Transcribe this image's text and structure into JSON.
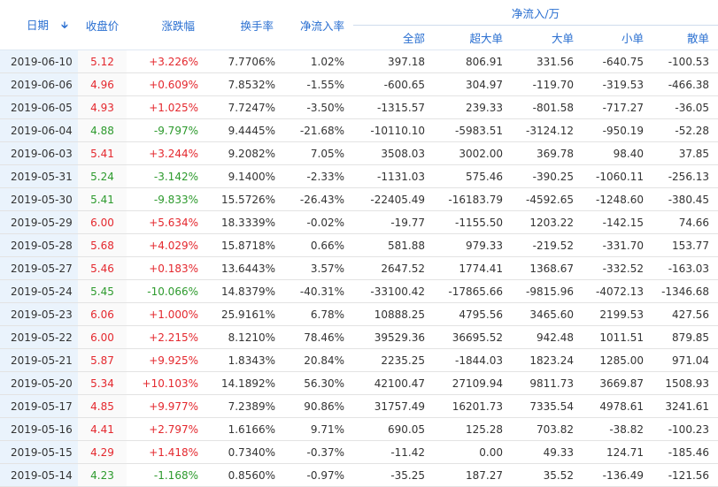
{
  "header": {
    "date": "日期",
    "sort_icon": "arrow-down",
    "close": "收盘价",
    "change": "涨跌幅",
    "turnover": "换手率",
    "netflow_rate": "净流入率",
    "netflow_group": "净流入/万",
    "all": "全部",
    "super_large": "超大单",
    "large": "大单",
    "small": "小单",
    "retail": "散单"
  },
  "colors": {
    "up": "#e4282e",
    "down": "#2d9a2d",
    "header": "#2a6fd1",
    "date_bg": "#eaf3fc"
  },
  "rows": [
    {
      "date": "2019-06-10",
      "close": "5.12",
      "change": "+3.226%",
      "turnover": "7.7706%",
      "rate": "1.02%",
      "all": "397.18",
      "super": "806.91",
      "large": "331.56",
      "small": "-640.75",
      "retail": "-100.53",
      "dir": "up"
    },
    {
      "date": "2019-06-06",
      "close": "4.96",
      "change": "+0.609%",
      "turnover": "7.8532%",
      "rate": "-1.55%",
      "all": "-600.65",
      "super": "304.97",
      "large": "-119.70",
      "small": "-319.53",
      "retail": "-466.38",
      "dir": "up"
    },
    {
      "date": "2019-06-05",
      "close": "4.93",
      "change": "+1.025%",
      "turnover": "7.7247%",
      "rate": "-3.50%",
      "all": "-1315.57",
      "super": "239.33",
      "large": "-801.58",
      "small": "-717.27",
      "retail": "-36.05",
      "dir": "up"
    },
    {
      "date": "2019-06-04",
      "close": "4.88",
      "change": "-9.797%",
      "turnover": "9.4445%",
      "rate": "-21.68%",
      "all": "-10110.10",
      "super": "-5983.51",
      "large": "-3124.12",
      "small": "-950.19",
      "retail": "-52.28",
      "dir": "down"
    },
    {
      "date": "2019-06-03",
      "close": "5.41",
      "change": "+3.244%",
      "turnover": "9.2082%",
      "rate": "7.05%",
      "all": "3508.03",
      "super": "3002.00",
      "large": "369.78",
      "small": "98.40",
      "retail": "37.85",
      "dir": "up"
    },
    {
      "date": "2019-05-31",
      "close": "5.24",
      "change": "-3.142%",
      "turnover": "9.1400%",
      "rate": "-2.33%",
      "all": "-1131.03",
      "super": "575.46",
      "large": "-390.25",
      "small": "-1060.11",
      "retail": "-256.13",
      "dir": "down"
    },
    {
      "date": "2019-05-30",
      "close": "5.41",
      "change": "-9.833%",
      "turnover": "15.5726%",
      "rate": "-26.43%",
      "all": "-22405.49",
      "super": "-16183.79",
      "large": "-4592.65",
      "small": "-1248.60",
      "retail": "-380.45",
      "dir": "down"
    },
    {
      "date": "2019-05-29",
      "close": "6.00",
      "change": "+5.634%",
      "turnover": "18.3339%",
      "rate": "-0.02%",
      "all": "-19.77",
      "super": "-1155.50",
      "large": "1203.22",
      "small": "-142.15",
      "retail": "74.66",
      "dir": "up"
    },
    {
      "date": "2019-05-28",
      "close": "5.68",
      "change": "+4.029%",
      "turnover": "15.8718%",
      "rate": "0.66%",
      "all": "581.88",
      "super": "979.33",
      "large": "-219.52",
      "small": "-331.70",
      "retail": "153.77",
      "dir": "up"
    },
    {
      "date": "2019-05-27",
      "close": "5.46",
      "change": "+0.183%",
      "turnover": "13.6443%",
      "rate": "3.57%",
      "all": "2647.52",
      "super": "1774.41",
      "large": "1368.67",
      "small": "-332.52",
      "retail": "-163.03",
      "dir": "up"
    },
    {
      "date": "2019-05-24",
      "close": "5.45",
      "change": "-10.066%",
      "turnover": "14.8379%",
      "rate": "-40.31%",
      "all": "-33100.42",
      "super": "-17865.66",
      "large": "-9815.96",
      "small": "-4072.13",
      "retail": "-1346.68",
      "dir": "down"
    },
    {
      "date": "2019-05-23",
      "close": "6.06",
      "change": "+1.000%",
      "turnover": "25.9161%",
      "rate": "6.78%",
      "all": "10888.25",
      "super": "4795.56",
      "large": "3465.60",
      "small": "2199.53",
      "retail": "427.56",
      "dir": "up"
    },
    {
      "date": "2019-05-22",
      "close": "6.00",
      "change": "+2.215%",
      "turnover": "8.1210%",
      "rate": "78.46%",
      "all": "39529.36",
      "super": "36695.52",
      "large": "942.48",
      "small": "1011.51",
      "retail": "879.85",
      "dir": "up"
    },
    {
      "date": "2019-05-21",
      "close": "5.87",
      "change": "+9.925%",
      "turnover": "1.8343%",
      "rate": "20.84%",
      "all": "2235.25",
      "super": "-1844.03",
      "large": "1823.24",
      "small": "1285.00",
      "retail": "971.04",
      "dir": "up"
    },
    {
      "date": "2019-05-20",
      "close": "5.34",
      "change": "+10.103%",
      "turnover": "14.1892%",
      "rate": "56.30%",
      "all": "42100.47",
      "super": "27109.94",
      "large": "9811.73",
      "small": "3669.87",
      "retail": "1508.93",
      "dir": "up"
    },
    {
      "date": "2019-05-17",
      "close": "4.85",
      "change": "+9.977%",
      "turnover": "7.2389%",
      "rate": "90.86%",
      "all": "31757.49",
      "super": "16201.73",
      "large": "7335.54",
      "small": "4978.61",
      "retail": "3241.61",
      "dir": "up"
    },
    {
      "date": "2019-05-16",
      "close": "4.41",
      "change": "+2.797%",
      "turnover": "1.6166%",
      "rate": "9.71%",
      "all": "690.05",
      "super": "125.28",
      "large": "703.82",
      "small": "-38.82",
      "retail": "-100.23",
      "dir": "up"
    },
    {
      "date": "2019-05-15",
      "close": "4.29",
      "change": "+1.418%",
      "turnover": "0.7340%",
      "rate": "-0.37%",
      "all": "-11.42",
      "super": "0.00",
      "large": "49.33",
      "small": "124.71",
      "retail": "-185.46",
      "dir": "up"
    },
    {
      "date": "2019-05-14",
      "close": "4.23",
      "change": "-1.168%",
      "turnover": "0.8560%",
      "rate": "-0.97%",
      "all": "-35.25",
      "super": "187.27",
      "large": "35.52",
      "small": "-136.49",
      "retail": "-121.56",
      "dir": "down"
    }
  ]
}
